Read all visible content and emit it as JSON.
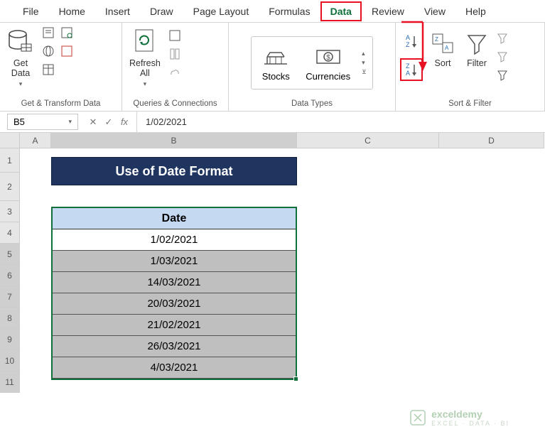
{
  "tabs": {
    "file": "File",
    "home": "Home",
    "insert": "Insert",
    "draw": "Draw",
    "page_layout": "Page Layout",
    "formulas": "Formulas",
    "data": "Data",
    "review": "Review",
    "view": "View",
    "help": "Help"
  },
  "ribbon": {
    "get_data": "Get\nData",
    "refresh_all": "Refresh\nAll",
    "group1_label": "Get & Transform Data",
    "group2_label": "Queries & Connections",
    "stocks": "Stocks",
    "currencies": "Currencies",
    "group3_label": "Data Types",
    "sort": "Sort",
    "filter": "Filter",
    "group4_label": "Sort & Filter"
  },
  "formula_bar": {
    "name_box": "B5",
    "formula": "1/02/2021"
  },
  "columns": {
    "A": "A",
    "B": "B",
    "C": "C",
    "D": "D"
  },
  "rows": {
    "r1": "1",
    "r2": "2",
    "r3": "3",
    "r4": "4",
    "r5": "5",
    "r6": "6",
    "r7": "7",
    "r8": "8",
    "r9": "9",
    "r10": "10",
    "r11": "11"
  },
  "sheet": {
    "title": "Use of Date Format",
    "header": "Date",
    "data": {
      "d0": "1/02/2021",
      "d1": "1/03/2021",
      "d2": "14/03/2021",
      "d3": "20/03/2021",
      "d4": "21/02/2021",
      "d5": "26/03/2021",
      "d6": "4/03/2021"
    }
  },
  "watermark": {
    "brand": "exceldemy",
    "tag": "EXCEL · DATA · BI"
  }
}
